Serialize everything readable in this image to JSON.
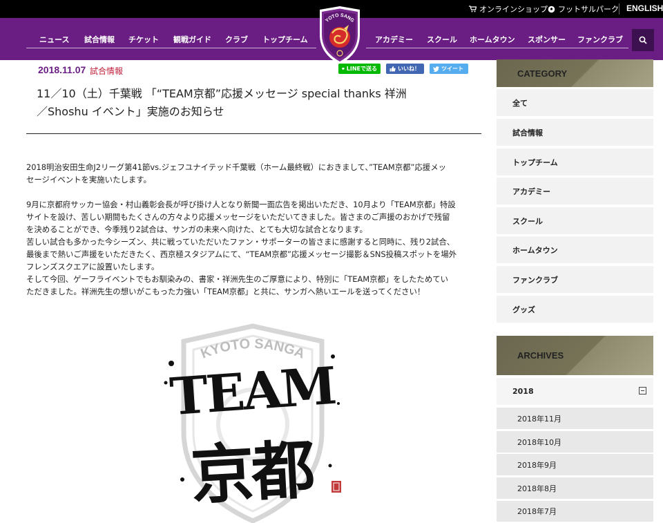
{
  "utility": {
    "shop_label": "オンラインショップ",
    "futsal_label": "フットサルパーク",
    "language_label": "ENGLISH"
  },
  "nav": {
    "left": [
      "ニュース",
      "試合情報",
      "チケット",
      "観戦ガイド",
      "クラブ",
      "トップチーム"
    ],
    "right": [
      "アカデミー",
      "スクール",
      "ホームタウン",
      "スポンサー",
      "ファンクラブ"
    ]
  },
  "emblem": {
    "text": "KYOTO SANGA"
  },
  "article": {
    "date": "2018.11.07",
    "category": "試合情報",
    "title_lines": [
      "11／10（土）千葉戦 「“TEAM京都”応援メッセージ special thanks 祥洲",
      "／Shoshu イベント」実施のお知らせ"
    ],
    "paragraphs": [
      "2018明治安田生命J2リーグ第41節vs.ジェフユナイテッド千葉戦（ホーム最終戦）におきまして、”TEAM京都”応援メッ",
      "セージイベントを実施いたします。",
      "",
      "9月に京都府サッカー協会・村山義彰会長が呼び掛け人となり新聞一面広告を掲出いただき、10月より「TEAM京都」特設",
      "サイトを設け、苦しい期間もたくさんの方々より応援メッセージをいただいてきました。皆さまのご声援のおかげで残留",
      "を決めることができ、今季残り2試合は、サンガの未来へ向けた、とても大切な試合となります。",
      "苦しい試合も多かった今シーズン、共に戦っていただいたファン・サポーターの皆さまに感謝すると同時に、残り2試合、",
      "最後まで熱いご声援をいただきたく、西京極スタジアムにて、“TEAM京都”応援メッセージ撮影＆SNS投稿スポットを場外",
      "フレンズスクエアに設置いたします。",
      "そして今回、ゲーフライベントでもお馴染みの、書家・祥洲先生のご厚意により、特別に「TEAM京都」をしたためてい",
      "ただきました。祥洲先生の想いがこもった力強い「TEAM京都」と共に、サンガへ熱いエールを送ってください！"
    ],
    "art": {
      "line1": "TEAM",
      "line2": "京都",
      "emblem_text": "KYOTO SANGA"
    }
  },
  "share": {
    "line_label": "LINEで送る",
    "facebook_label": "いいね！",
    "twitter_label": "ツイート"
  },
  "sidebar": {
    "category_heading": "CATEGORY",
    "categories": [
      "全て",
      "試合情報",
      "トップチーム",
      "アカデミー",
      "スクール",
      "ホームタウン",
      "ファンクラブ",
      "グッズ"
    ],
    "archives_heading": "ARCHIVES",
    "year": "2018",
    "months": [
      "2018年11月",
      "2018年10月",
      "2018年9月",
      "2018年8月",
      "2018年7月"
    ]
  },
  "colors": {
    "brand_purple": "#6a1e84",
    "category_red": "#c0213c",
    "line_green": "#00b900",
    "facebook_blue": "#4267b2",
    "twitter_blue": "#55acee",
    "sidebar_olive": "#777357"
  }
}
